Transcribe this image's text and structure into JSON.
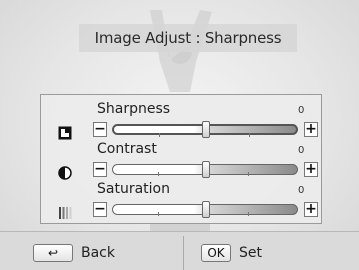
{
  "title": "Image Adjust : Sharpness",
  "sliders": [
    {
      "label": "Sharpness",
      "value": "0",
      "icon": "sharpness-icon",
      "selected": true
    },
    {
      "label": "Contrast",
      "value": "0",
      "icon": "contrast-icon",
      "selected": false
    },
    {
      "label": "Saturation",
      "value": "0",
      "icon": "saturation-icon",
      "selected": false
    }
  ],
  "buttons": {
    "minus": "−",
    "plus": "+"
  },
  "bottom_bar": {
    "back_key": "↩",
    "back_label": "Back",
    "ok_key": "OK",
    "set_label": "Set"
  },
  "colors": {
    "track_dark": "#8a8a8a",
    "panel_bg": "#ececec"
  }
}
